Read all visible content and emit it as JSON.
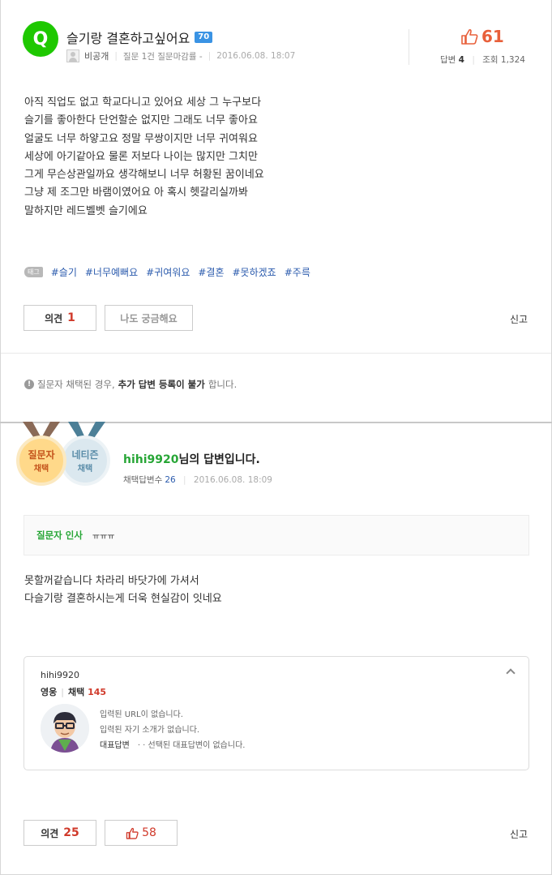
{
  "question": {
    "badge": "Q",
    "title": "슬기랑 결혼하고싶어요",
    "level": "70",
    "author": "비공개",
    "meta": "질문 1건 질문마감률 -",
    "date": "2016.06.08. 18:07",
    "likes": "61",
    "answers_label": "답변",
    "answers": "4",
    "views_label": "조회",
    "views": "1,324",
    "body": [
      "아직 직업도 없고 학교다니고 있어요 세상 그 누구보다",
      "슬기를 좋아한다 단언할순 없지만 그래도 너무 좋아요",
      "얼굴도 너무 하얗고요 정말 무쌍이지만 너무 귀여워요",
      "세상에 아기같아요 물론 저보다 나이는 많지만 그치만",
      "그게 무슨상관일까요 생각해보니 너무 허황된 꿈이네요",
      "그냥 제 조그만 바램이였어요 아 혹시 헷갈리실까봐",
      "말하지만 레드벨벳 슬기에요"
    ],
    "tag_label": "태그",
    "tags": [
      "#슬기",
      "#너무예뻐요",
      "#귀여워요",
      "#결혼",
      "#못하겠죠",
      "#주륵"
    ],
    "opinion_label": "의견",
    "opinion_count": "1",
    "curious_label": "나도 궁금해요",
    "report_label": "신고"
  },
  "notice": {
    "pre": "질문자 채택된 경우, ",
    "bold": "추가 답변 등록이 불가",
    "post": "합니다."
  },
  "answer": {
    "medal_asker_1": "질문자",
    "medal_asker_2": "채택",
    "medal_citizen_1": "네티즌",
    "medal_citizen_2": "채택",
    "user_id": "hihi9920",
    "title_suffix": "님의 답변입니다.",
    "adopted_label": "채택답변수",
    "adopted_count": "26",
    "date": "2016.06.08. 18:09",
    "greet_label": "질문자 인사",
    "greet_text": "ㅠㅠㅠ",
    "body": [
      "못할꺼같습니다 차라리 바닷가에 가셔서",
      "다슬기랑 결혼하시는게 더욱 현실감이 잇네요"
    ],
    "profile": {
      "name": "hihi9920",
      "grade": "영웅",
      "adopt_label": "채택",
      "adopt_count": "145",
      "url_text": "입력된 URL이 없습니다.",
      "intro_text": "입력된 자기 소개가 없습니다.",
      "rep_label": "대표답변",
      "rep_text": "· · 선택된 대표답변이 없습니다."
    },
    "opinion_label": "의견",
    "opinion_count": "25",
    "like_count": "58",
    "report_label": "신고"
  },
  "colors": {
    "green": "#1ec800",
    "like": "#e8603b",
    "count_red": "#d03a2b",
    "tag_blue": "#2b5bad"
  }
}
